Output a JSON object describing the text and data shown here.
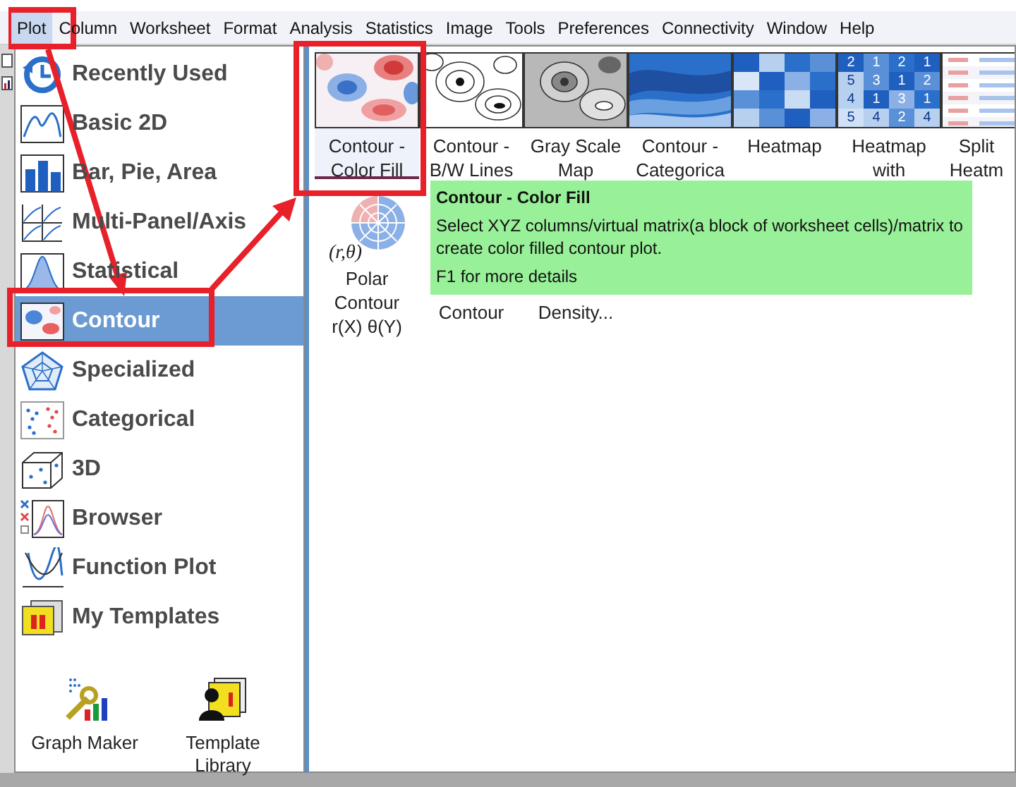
{
  "menu_bar": [
    {
      "label": "Plot",
      "selected": true
    },
    {
      "label": "Column",
      "selected": false
    },
    {
      "label": "Worksheet",
      "selected": false
    },
    {
      "label": "Format",
      "selected": false
    },
    {
      "label": "Analysis",
      "selected": false
    },
    {
      "label": "Statistics",
      "selected": false
    },
    {
      "label": "Image",
      "selected": false
    },
    {
      "label": "Tools",
      "selected": false
    },
    {
      "label": "Preferences",
      "selected": false
    },
    {
      "label": "Connectivity",
      "selected": false
    },
    {
      "label": "Window",
      "selected": false
    },
    {
      "label": "Help",
      "selected": false
    }
  ],
  "categories": [
    {
      "label": "Recently Used",
      "selected": false
    },
    {
      "label": "Basic 2D",
      "selected": false
    },
    {
      "label": "Bar, Pie, Area",
      "selected": false
    },
    {
      "label": "Multi-Panel/Axis",
      "selected": false
    },
    {
      "label": "Statistical",
      "selected": false
    },
    {
      "label": "Contour",
      "selected": true
    },
    {
      "label": "Specialized",
      "selected": false
    },
    {
      "label": "Categorical",
      "selected": false
    },
    {
      "label": "3D",
      "selected": false
    },
    {
      "label": "Browser",
      "selected": false
    },
    {
      "label": "Function Plot",
      "selected": false
    },
    {
      "label": "My Templates",
      "selected": false
    }
  ],
  "tools": [
    {
      "label": "Graph Maker"
    },
    {
      "label": "Template Library"
    }
  ],
  "gallery": [
    {
      "kind": "contour_color",
      "label": "Contour - Color Fill",
      "selected": true
    },
    {
      "kind": "contour_lines",
      "label": "Contour - B/W Lines",
      "selected": false
    },
    {
      "kind": "gray_map",
      "label": "Gray Scale Map",
      "selected": false
    },
    {
      "kind": "contour_categorical",
      "label": "Contour - Categorica",
      "selected": false
    },
    {
      "kind": "heatmap",
      "label": "Heatmap",
      "selected": false
    },
    {
      "kind": "heatmap_labels",
      "label": "Heatmap with",
      "selected": false,
      "cell_values": [
        "2",
        "1",
        "2",
        "1",
        "5",
        "3",
        "1",
        "2",
        "4",
        "1",
        "3",
        "1",
        "5",
        "4",
        "2",
        "4"
      ]
    },
    {
      "kind": "split_heatmap",
      "label": "Split Heatm",
      "selected": false
    },
    {
      "kind": "polar",
      "label": "Polar Contour r(X) θ(Y)",
      "selected": false,
      "icon_text": "(r,θ)"
    },
    {
      "kind": "hidden",
      "label": "Contour",
      "selected": false
    },
    {
      "kind": "hidden",
      "label": "Density...",
      "selected": false
    }
  ],
  "tooltip": {
    "title": "Contour - Color Fill",
    "description": "Select XYZ columns/virtual matrix(a block of worksheet cells)/matrix to create color filled contour plot.",
    "hint": "F1 for more details"
  }
}
